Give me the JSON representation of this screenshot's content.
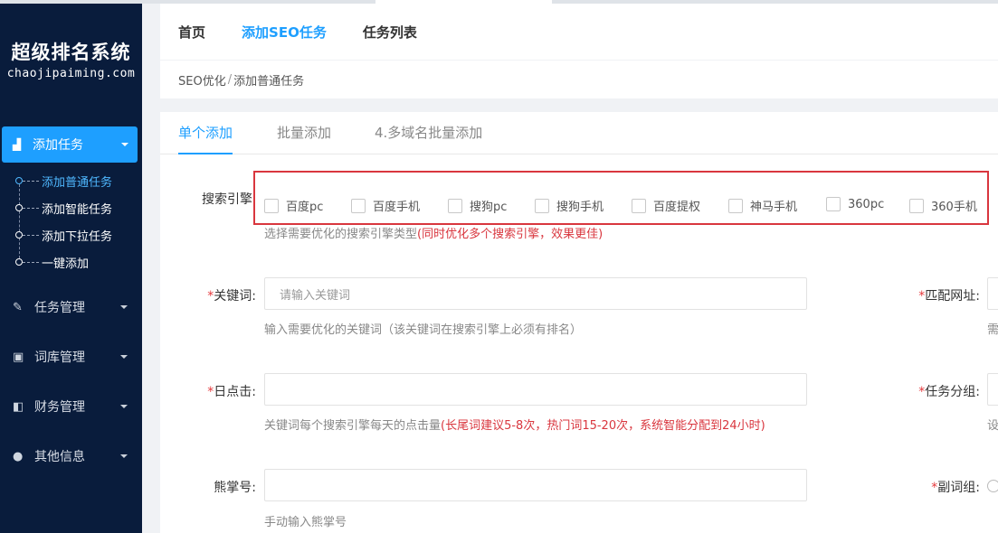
{
  "sidebar": {
    "logo_title": "超级排名系统",
    "logo_sub": "chaojipaiming.com",
    "active": {
      "label": "添加任务",
      "icon": "chart-icon"
    },
    "subitems": [
      {
        "label": "添加普通任务",
        "current": true
      },
      {
        "label": "添加智能任务"
      },
      {
        "label": "添加下拉任务"
      },
      {
        "label": "一键添加"
      }
    ],
    "items": [
      {
        "label": "任务管理",
        "icon": "edit-icon"
      },
      {
        "label": "词库管理",
        "icon": "book-icon"
      },
      {
        "label": "财务管理",
        "icon": "wallet-icon"
      },
      {
        "label": "其他信息",
        "icon": "chat-icon"
      }
    ]
  },
  "header": {
    "nav": [
      "首页",
      "添加SEO任务",
      "任务列表"
    ],
    "active_nav": "添加SEO任务"
  },
  "breadcrumb": {
    "parent": "SEO优化",
    "separator": "/",
    "current": "添加普通任务"
  },
  "tabs": [
    "单个添加",
    "批量添加",
    "4.多域名批量添加"
  ],
  "form": {
    "engines_label": "搜索引擎",
    "engines": [
      "百度pc",
      "百度手机",
      "搜狗pc",
      "搜狗手机",
      "百度提权",
      "神马手机",
      "360pc",
      "360手机"
    ],
    "engines_hint": "选择需要优化的搜索引擎类型",
    "engines_hint_red": "(同时优化多个搜索引擎，效果更佳)",
    "keyword_label": "关键词:",
    "keyword_placeholder": "请输入关键词",
    "keyword_hint": "输入需要优化的关键词（该关键词在搜索引擎上必须有排名）",
    "match_url_label": "匹配网址:",
    "match_url_hint_cut": "需",
    "daily_clicks_label": "日点击:",
    "daily_clicks_hint": "关键词每个搜索引擎每天的点击量",
    "daily_clicks_hint_red": "(长尾词建议5-8次，热门词15-20次，系统智能分配到24小时)",
    "task_group_label": "任务分组:",
    "task_group_hint_cut": "设",
    "xiongzhang_label": "熊掌号:",
    "xiongzhang_hint": "手动输入熊掌号",
    "sub_group_label": "副词组:"
  },
  "colors": {
    "accent": "#1e9fff",
    "sidebar_bg": "#091c3c",
    "highlight_border": "#d9363e"
  }
}
